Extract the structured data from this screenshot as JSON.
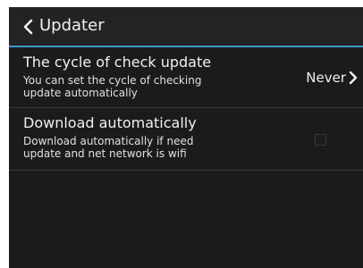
{
  "header": {
    "title": "Updater"
  },
  "settings": {
    "check_cycle": {
      "title": "The cycle of check update",
      "summary_line1": "You can set the cycle of checking",
      "summary_line2": "update automatically",
      "value": "Never"
    },
    "auto_download": {
      "title": "Download automatically",
      "summary_line1": "Download automatically if need",
      "summary_line2": "update and net network is wifi",
      "checked": false
    }
  },
  "colors": {
    "background": "#1b1b1b",
    "action_bar": "#232323",
    "accent": "#3a9bcf",
    "text": "#f0f0f0"
  },
  "icons": {
    "back": "chevron-left-icon",
    "value_arrow": "chevron-right-icon"
  }
}
